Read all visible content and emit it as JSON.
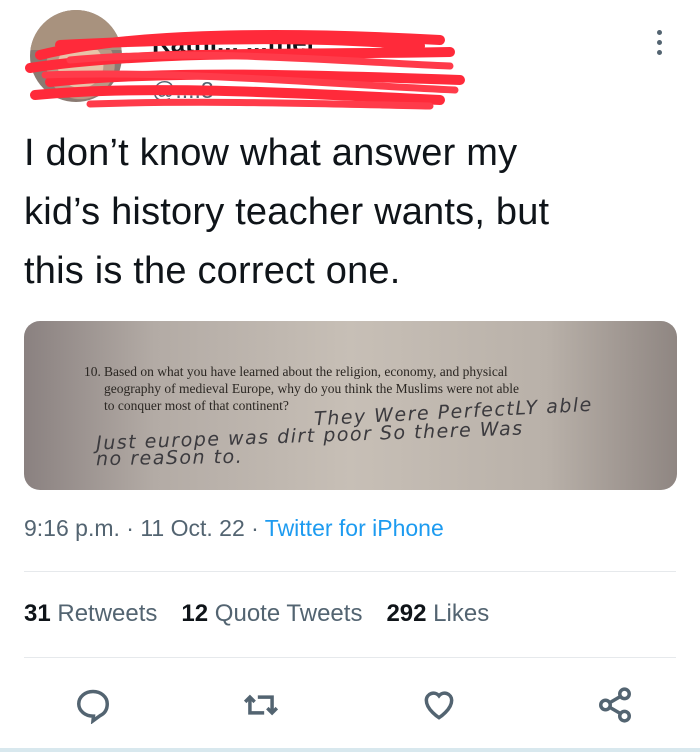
{
  "user": {
    "display_name": "Kathl... ...ther",
    "handle": "@....3",
    "avatar_icon": "avatar-photo",
    "redaction_color": "#ff2a3a"
  },
  "tweet": {
    "text": "I don’t know what answer my\nkid’s history teacher wants, but\nthis is the correct one."
  },
  "photo": {
    "question_number": "10.",
    "question_lines": [
      "Based on what you have learned about the religion, economy, and physical",
      "geography of medieval Europe, why do you think the Muslims were not able",
      "to conquer most of that continent?"
    ],
    "handwritten_lines": [
      "They Were PerfectLY able",
      "Just   europe was dirt poor So there  Was",
      "no reaSon to."
    ]
  },
  "meta": {
    "time": "9:16 p.m.",
    "separator": " · ",
    "date": "11 Oct. 22",
    "source": "Twitter for iPhone"
  },
  "stats": {
    "retweets_count": "31",
    "retweets_label": "Retweets",
    "quotes_count": "12",
    "quotes_label": "Quote Tweets",
    "likes_count": "292",
    "likes_label": "Likes"
  },
  "actions": {
    "reply_icon": "reply-icon",
    "retweet_icon": "retweet-icon",
    "like_icon": "heart-icon",
    "share_icon": "share-icon",
    "icon_color": "#536471"
  },
  "colors": {
    "link": "#1d9bf0",
    "muted": "#536471",
    "text": "#0f1419"
  }
}
